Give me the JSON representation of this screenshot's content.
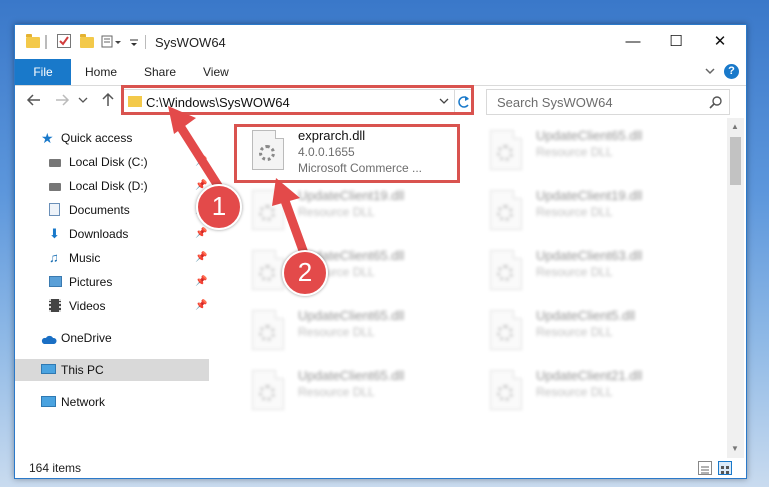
{
  "window": {
    "title": "SysWOW64"
  },
  "ribbon": {
    "file": "File",
    "home": "Home",
    "share": "Share",
    "view": "View"
  },
  "address": {
    "path": "C:\\Windows\\SysWOW64"
  },
  "search": {
    "placeholder": "Search SysWOW64"
  },
  "sidebar": {
    "items": [
      {
        "label": "Quick access"
      },
      {
        "label": "Local Disk (C:)"
      },
      {
        "label": "Local Disk (D:)"
      },
      {
        "label": "Documents"
      },
      {
        "label": "Downloads"
      },
      {
        "label": "Music"
      },
      {
        "label": "Pictures"
      },
      {
        "label": "Videos"
      },
      {
        "label": "OneDrive"
      },
      {
        "label": "This PC"
      },
      {
        "label": "Network"
      }
    ]
  },
  "files": {
    "highlight": {
      "name": "exprarch.dll",
      "version": "4.0.0.1655",
      "desc": "Microsoft Commerce ..."
    },
    "others": [
      {
        "name": "UpdateClient65.dll",
        "type": "Resource DLL"
      },
      {
        "name": "UpdateClient19.dll",
        "type": "Resource DLL"
      },
      {
        "name": "UpdateClient19.dll",
        "type": "Resource DLL"
      },
      {
        "name": "UpdateClient65.dll",
        "type": "Resource DLL"
      },
      {
        "name": "UpdateClient63.dll",
        "type": "Resource DLL"
      },
      {
        "name": "UpdateClient65.dll",
        "type": "Resource DLL"
      },
      {
        "name": "UpdateClient5.dll",
        "type": "Resource DLL"
      },
      {
        "name": "UpdateClient65.dll",
        "type": "Resource DLL"
      },
      {
        "name": "UpdateClient21.dll",
        "type": "Resource DLL"
      }
    ]
  },
  "status": {
    "count": "164 items"
  },
  "annotations": {
    "badge1": "1",
    "badge2": "2"
  },
  "colors": {
    "accent": "#1979ca",
    "annotation": "#e34a4a"
  }
}
